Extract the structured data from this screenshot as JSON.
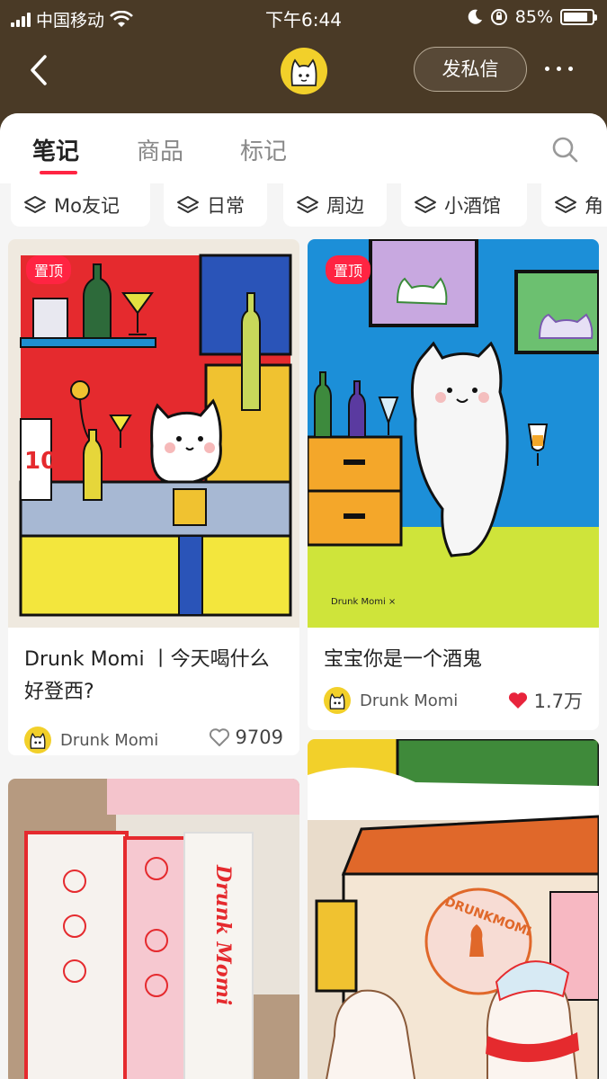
{
  "status_bar": {
    "carrier": "中国移动",
    "time": "下午6:44",
    "battery_percent": "85%",
    "battery_level": 0.85
  },
  "nav": {
    "send_message_label": "发私信"
  },
  "tabs": [
    {
      "label": "笔记",
      "active": true
    },
    {
      "label": "商品",
      "active": false
    },
    {
      "label": "标记",
      "active": false
    }
  ],
  "collections": [
    {
      "label": "Mo友记"
    },
    {
      "label": "日常"
    },
    {
      "label": "周边"
    },
    {
      "label": "小酒馆"
    },
    {
      "label": "角"
    }
  ],
  "notes": [
    {
      "pinned_label": "置顶",
      "title": "Drunk Momi 丨今天喝什么好登西?",
      "author": "Drunk Momi",
      "likes": "9709",
      "liked": false
    },
    {
      "pinned_label": "置顶",
      "title": "宝宝你是一个酒鬼",
      "author": "Drunk Momi",
      "likes": "1.7万",
      "liked": true
    },
    {
      "title": "",
      "author": "",
      "likes": ""
    },
    {
      "title": "",
      "author": "",
      "likes": ""
    }
  ],
  "images": {
    "note2_signature": "Drunk Momi ×",
    "note3_product_text": "Drunk Momi",
    "note4_sign_text": "DRUNKMOMI"
  },
  "colors": {
    "header_bg": "#4a3a26",
    "accent_red": "#ff2442",
    "avatar_yellow": "#f2d02a"
  }
}
